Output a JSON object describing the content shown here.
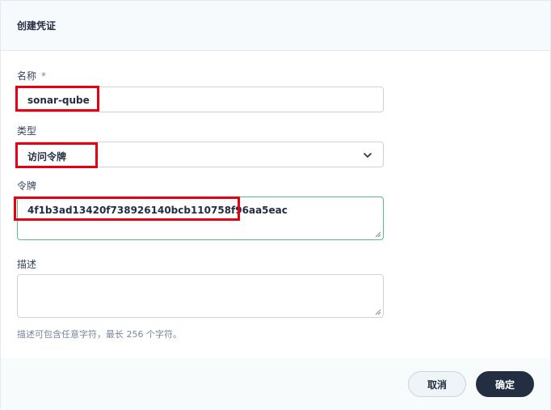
{
  "dialog": {
    "title": "创建凭证"
  },
  "form": {
    "name_label": "名称",
    "required_mark": "*",
    "name_value": "sonar-qube",
    "type_label": "类型",
    "type_value": "访问令牌",
    "token_label": "令牌",
    "token_value": "4f1b3ad13420f738926140bcb110758f96aa5eac",
    "desc_label": "描述",
    "desc_value": "",
    "desc_hint": "描述可包含任意字符，最长 256 个字符。"
  },
  "buttons": {
    "cancel": "取消",
    "ok": "确定"
  },
  "colors": {
    "highlight": "#e60012",
    "primary": "#242e42",
    "active_border": "#55bc8a"
  }
}
